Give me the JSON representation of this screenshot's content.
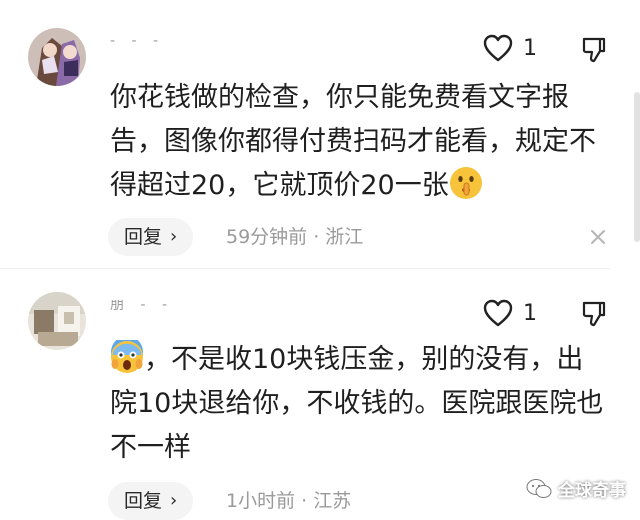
{
  "comments": [
    {
      "author": "- -  -",
      "likes": "1",
      "text_line1": "你花钱做的检查，你只能免费看文字报",
      "text_line2": "告，图像你都得付费扫码才能看，规定不",
      "text_line3": "得超过20，它就顶价20一张",
      "emoji": "shushing-face-icon",
      "reply_label": "回复",
      "meta": "59分钟前 · 浙江"
    },
    {
      "author": "朋  -  -",
      "likes": "1",
      "text_line1": "，不是收10块钱压金，别的没有，出",
      "text_line2": "院10块退给你，不收钱的。医院跟医院也",
      "text_line3": "不一样",
      "emoji": "screaming-face-icon",
      "reply_label": "回复",
      "meta": "1小时前 · 江苏"
    }
  ],
  "watermark": "全球奇事",
  "colors": {
    "meta": "#9a9a9a",
    "reply_bg": "#f4f4f4",
    "text": "#1f1f1f"
  }
}
